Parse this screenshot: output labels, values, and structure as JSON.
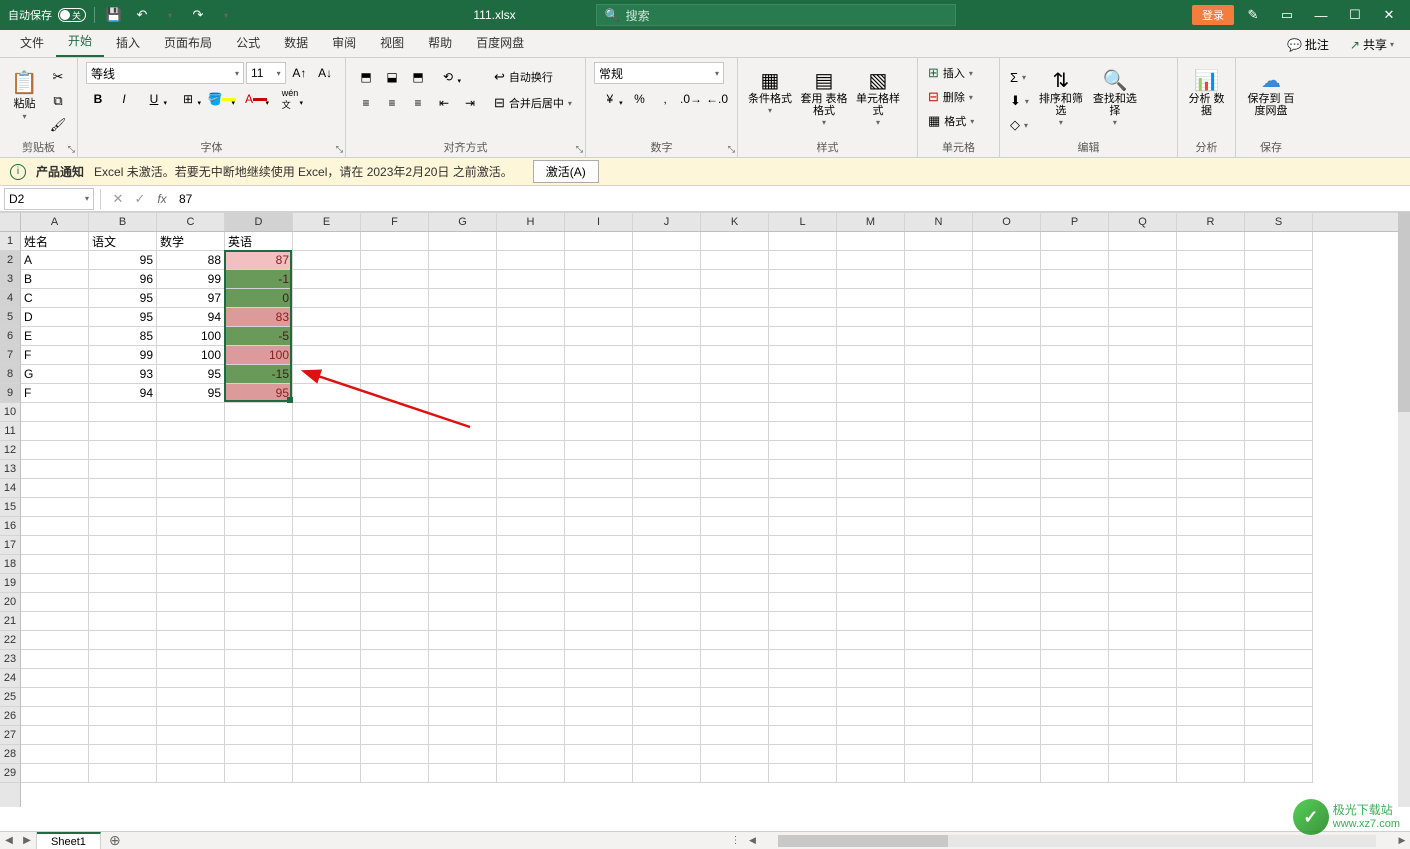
{
  "titleBar": {
    "autosave": "自动保存",
    "toggleLabel": "关",
    "filename": "111.xlsx",
    "searchPlaceholder": "搜索",
    "login": "登录"
  },
  "tabs": {
    "file": "文件",
    "home": "开始",
    "insert": "插入",
    "layout": "页面布局",
    "formula": "公式",
    "data": "数据",
    "review": "审阅",
    "view": "视图",
    "help": "帮助",
    "baidu": "百度网盘",
    "comments": "批注",
    "share": "共享"
  },
  "ribbon": {
    "clipboard": {
      "label": "剪贴板",
      "paste": "粘贴"
    },
    "font": {
      "label": "字体",
      "name": "等线",
      "size": "11"
    },
    "align": {
      "label": "对齐方式",
      "wrap": "自动换行",
      "merge": "合并后居中"
    },
    "number": {
      "label": "数字",
      "format": "常规"
    },
    "styles": {
      "label": "样式",
      "cond": "条件格式",
      "table": "套用\n表格格式",
      "cell": "单元格样式"
    },
    "cells": {
      "label": "单元格",
      "insert": "插入",
      "delete": "删除",
      "format": "格式"
    },
    "editing": {
      "label": "编辑",
      "sort": "排序和筛选",
      "find": "查找和选择"
    },
    "analysis": {
      "label": "分析",
      "btn": "分析\n数据"
    },
    "save": {
      "label": "保存",
      "btn": "保存到\n百度网盘"
    }
  },
  "notif": {
    "title": "产品通知",
    "msg": "Excel 未激活。若要无中断地继续使用 Excel，请在 2023年2月20日 之前激活。",
    "btn": "激活(A)"
  },
  "nameBox": "D2",
  "formula": "87",
  "columns": [
    "A",
    "B",
    "C",
    "D",
    "E",
    "F",
    "G",
    "H",
    "I",
    "J",
    "K",
    "L",
    "M",
    "N",
    "O",
    "P",
    "Q",
    "R",
    "S"
  ],
  "selectedCol": "D",
  "rowsCount": 29,
  "selectedRows": [
    2,
    3,
    4,
    5,
    6,
    7,
    8,
    9
  ],
  "headers": {
    "A": "姓名",
    "B": "语文",
    "C": "数学",
    "D": "英语"
  },
  "data": [
    {
      "A": "A",
      "B": 95,
      "C": 88,
      "D": 87,
      "cf": "lightpink"
    },
    {
      "A": "B",
      "B": 96,
      "C": 99,
      "D": -1,
      "cf": "green"
    },
    {
      "A": "C",
      "B": 95,
      "C": 97,
      "D": 0,
      "cf": "green"
    },
    {
      "A": "D",
      "B": 95,
      "C": 94,
      "D": 83,
      "cf": "pink"
    },
    {
      "A": "E",
      "B": 85,
      "C": 100,
      "D": -5,
      "cf": "green"
    },
    {
      "A": "F",
      "B": 99,
      "C": 100,
      "D": 100,
      "cf": "pink"
    },
    {
      "A": "G",
      "B": 93,
      "C": 95,
      "D": -15,
      "cf": "green"
    },
    {
      "A": "F",
      "B": 94,
      "C": 95,
      "D": 95,
      "cf": "pink"
    }
  ],
  "sheet": "Sheet1",
  "watermark": {
    "t1": "极光下载站",
    "t2": "www.xz7.com"
  }
}
